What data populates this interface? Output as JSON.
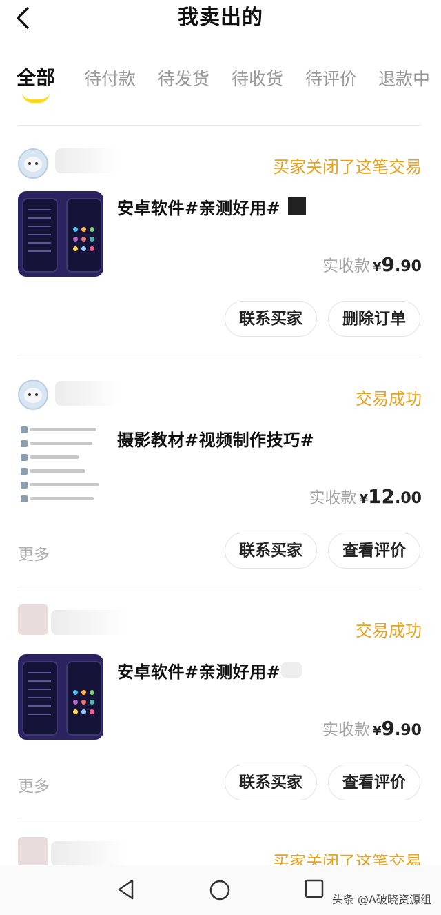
{
  "header": {
    "title": "我卖出的",
    "back_icon": "chevron-left-icon"
  },
  "tabs": [
    {
      "label": "全部",
      "active": true
    },
    {
      "label": "待付款",
      "active": false
    },
    {
      "label": "待发货",
      "active": false
    },
    {
      "label": "待收货",
      "active": false
    },
    {
      "label": "待评价",
      "active": false
    },
    {
      "label": "退款中",
      "active": false
    }
  ],
  "colors": {
    "accent": "#e8a21c",
    "tab_indicator": "#ffd91a",
    "muted": "#a5a5a5"
  },
  "orders": [
    {
      "status": "买家关闭了这笔交易",
      "title": "安卓软件#亲测好用#",
      "price_label": "实收款",
      "currency": "¥",
      "price_int": "9",
      "price_dec": ".90",
      "more": "",
      "buttons": [
        "联系买家",
        "删除订单"
      ]
    },
    {
      "status": "交易成功",
      "title": "摄影教材#视频制作技巧#",
      "price_label": "实收款",
      "currency": "¥",
      "price_int": "12",
      "price_dec": ".00",
      "more": "更多",
      "buttons": [
        "联系买家",
        "查看评价"
      ]
    },
    {
      "status": "交易成功",
      "title": "安卓软件#亲测好用#",
      "price_label": "实收款",
      "currency": "¥",
      "price_int": "9",
      "price_dec": ".90",
      "more": "更多",
      "buttons": [
        "联系买家",
        "查看评价"
      ]
    },
    {
      "status": "买家关闭了这笔交易"
    }
  ],
  "navbar": {
    "icons": [
      "back-triangle-icon",
      "home-circle-icon",
      "recents-square-icon"
    ]
  },
  "watermark": "头条 @A破晓资源组"
}
